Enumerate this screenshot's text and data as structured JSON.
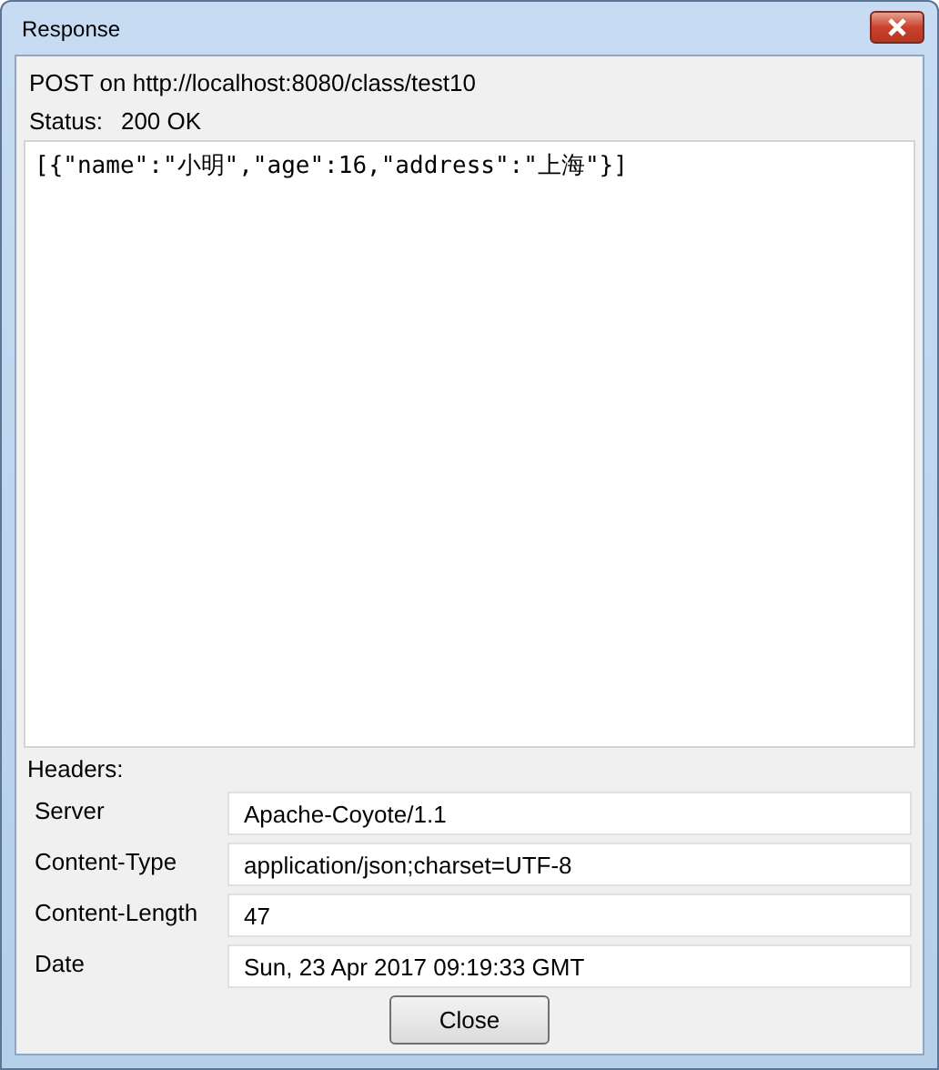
{
  "window": {
    "title": "Response"
  },
  "request_line": "POST on http://localhost:8080/class/test10",
  "status": {
    "label": "Status:",
    "value": "200 OK"
  },
  "body": "[{\"name\":\"小明\",\"age\":16,\"address\":\"上海\"}]",
  "headers": {
    "label": "Headers:",
    "rows": [
      {
        "name": "Server",
        "value": "Apache-Coyote/1.1"
      },
      {
        "name": "Content-Type",
        "value": "application/json;charset=UTF-8"
      },
      {
        "name": "Content-Length",
        "value": "47"
      },
      {
        "name": "Date",
        "value": "Sun, 23 Apr 2017 09:19:33 GMT"
      }
    ]
  },
  "buttons": [
    "Close"
  ]
}
